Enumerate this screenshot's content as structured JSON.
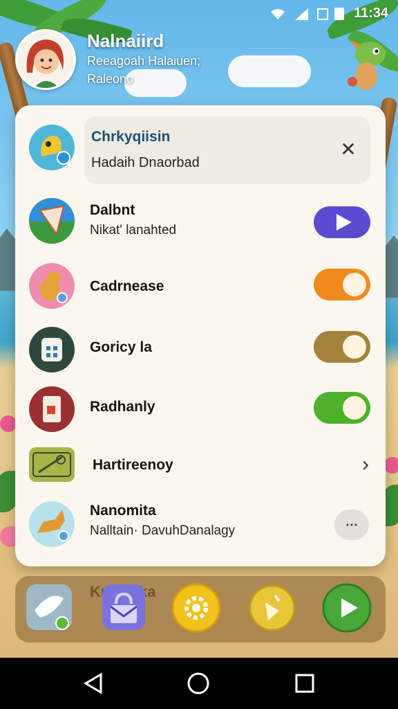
{
  "status_bar": {
    "time": "11:34"
  },
  "profile": {
    "name": "Nalnaiird",
    "subtitle": "Reeagoah Halaiuen;",
    "subtitle2": "Raleono"
  },
  "notification": {
    "title": "Chrkyqiisin",
    "subtitle": "Hadaih Dnaorbad"
  },
  "rows": [
    {
      "title": "Dalbnt",
      "subtitle": "Nikat' lanahted",
      "control": "play"
    },
    {
      "title": "Cadrnease",
      "control": "toggle",
      "color": "#f08a1c",
      "state": "on"
    },
    {
      "title": "Goricy la",
      "control": "toggle",
      "color": "#a4843c",
      "state": "on"
    },
    {
      "title": "Radhanly",
      "control": "toggle",
      "color": "#4fb12b",
      "state": "on"
    },
    {
      "title": "Hartireenoy",
      "control": "chevron"
    },
    {
      "title": "Nanomita",
      "subtitle": "Nalltain· DavuhDanalagy",
      "control": "more"
    }
  ],
  "dock": {
    "label": "Kmrnnka",
    "apps": [
      "messages-app",
      "mail-app",
      "settings-app",
      "music-app",
      "play-app"
    ]
  },
  "colors": {
    "accent_purple": "#5b4bd1",
    "toggle_orange": "#f08a1c",
    "toggle_olive": "#a4843c",
    "toggle_green": "#4fb12b"
  },
  "icons": {
    "back": "back-triangle-icon",
    "home": "home-circle-icon",
    "recents": "recents-square-icon"
  }
}
